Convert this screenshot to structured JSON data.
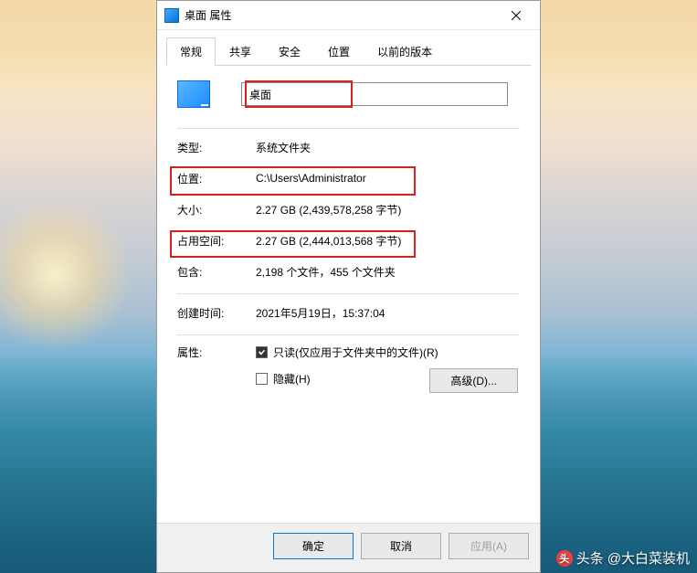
{
  "titlebar": {
    "title": "桌面 属性"
  },
  "tabs": [
    {
      "label": "常规",
      "active": true
    },
    {
      "label": "共享",
      "active": false
    },
    {
      "label": "安全",
      "active": false
    },
    {
      "label": "位置",
      "active": false
    },
    {
      "label": "以前的版本",
      "active": false
    }
  ],
  "name_field": {
    "value": "桌面"
  },
  "properties": {
    "type_label": "类型:",
    "type_value": "系统文件夹",
    "location_label": "位置:",
    "location_value": "C:\\Users\\Administrator",
    "size_label": "大小:",
    "size_value": "2.27 GB (2,439,578,258 字节)",
    "size_on_disk_label": "占用空间:",
    "size_on_disk_value": "2.27 GB (2,444,013,568 字节)",
    "contains_label": "包含:",
    "contains_value": "2,198 个文件，455 个文件夹",
    "created_label": "创建时间:",
    "created_value": "2021年5月19日，15:37:04",
    "attributes_label": "属性:"
  },
  "attributes": {
    "readonly_label": "只读(仅应用于文件夹中的文件)(R)",
    "readonly_checked": true,
    "hidden_label": "隐藏(H)",
    "hidden_checked": false,
    "advanced_label": "高级(D)..."
  },
  "footer": {
    "ok": "确定",
    "cancel": "取消",
    "apply": "应用(A)"
  },
  "watermark": {
    "prefix": "头条",
    "text": "@大白菜装机"
  },
  "colors": {
    "highlight": "#d82020",
    "accent": "#0078d4"
  }
}
